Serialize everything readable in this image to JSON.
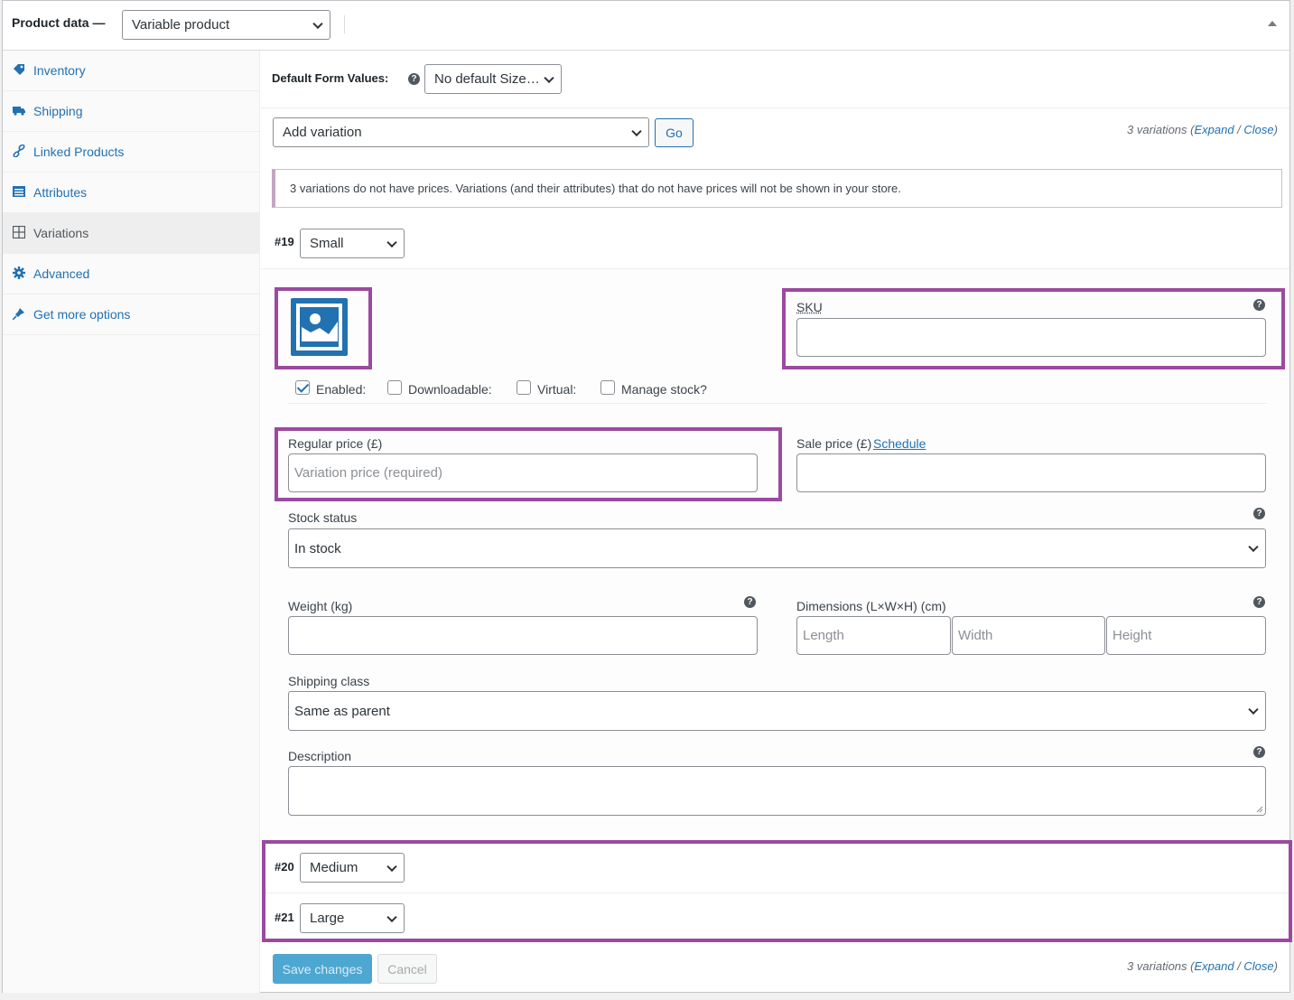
{
  "header": {
    "title": "Product data —",
    "product_type": "Variable product"
  },
  "sidebar": {
    "items": [
      {
        "label": "Inventory",
        "icon": "tag-icon"
      },
      {
        "label": "Shipping",
        "icon": "truck-icon"
      },
      {
        "label": "Linked Products",
        "icon": "link-icon"
      },
      {
        "label": "Attributes",
        "icon": "list-icon"
      },
      {
        "label": "Variations",
        "icon": "grid-icon",
        "active": true
      },
      {
        "label": "Advanced",
        "icon": "gear-icon"
      },
      {
        "label": "Get more options",
        "icon": "plugin-icon"
      }
    ]
  },
  "toolbar": {
    "default_form_label": "Default Form Values:",
    "default_form_value": "No default Size…",
    "add_variation": "Add variation",
    "go_label": "Go",
    "count_text": "3 variations (",
    "expand": "Expand",
    "sep": " / ",
    "close": "Close",
    "close_paren": ")"
  },
  "notice": "3 variations do not have prices. Variations (and their attributes) that do not have prices will not be shown in your store.",
  "variations": [
    {
      "id": "#19",
      "value": "Small"
    },
    {
      "id": "#20",
      "value": "Medium"
    },
    {
      "id": "#21",
      "value": "Large"
    }
  ],
  "form": {
    "sku_label": "SKU",
    "enabled_label": "Enabled:",
    "downloadable_label": "Downloadable:",
    "virtual_label": "Virtual:",
    "manage_stock_label": "Manage stock?",
    "regular_price_label": "Regular price (£)",
    "regular_price_placeholder": "Variation price (required)",
    "sale_price_label": "Sale price (£)",
    "schedule_link": "Schedule",
    "stock_status_label": "Stock status",
    "stock_status_value": "In stock",
    "weight_label": "Weight (kg)",
    "dimensions_label": "Dimensions (L×W×H) (cm)",
    "length_placeholder": "Length",
    "width_placeholder": "Width",
    "height_placeholder": "Height",
    "shipping_class_label": "Shipping class",
    "shipping_class_value": "Same as parent",
    "description_label": "Description"
  },
  "footer": {
    "save_label": "Save changes",
    "cancel_label": "Cancel"
  },
  "colors": {
    "accent": "#2271b1",
    "highlight": "#9b4aa0"
  }
}
